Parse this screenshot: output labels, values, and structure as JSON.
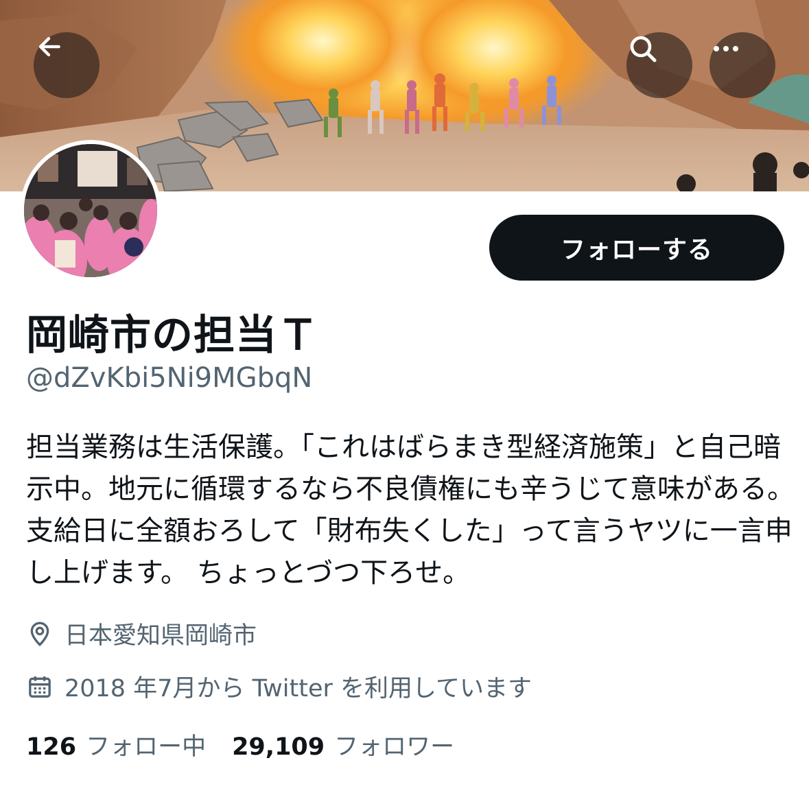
{
  "header": {
    "back_icon": "arrow-left-icon",
    "search_icon": "search-icon",
    "more_icon": "more-horizontal-icon"
  },
  "profile": {
    "display_name": "岡崎市の担当Ｔ",
    "handle": "@dZvKbi5Ni9MGbqN",
    "follow_label": "フォローする",
    "bio": "担当業務は生活保護。「これはばらまき型経済施策」と自己暗示中。地元に循環するなら不良債権にも辛うじて意味がある。 支給日に全額おろして「財布失くした」って言うヤツに一言申し上げます。 ちょっとづつ下ろせ。",
    "location": "日本愛知県岡崎市",
    "location_icon": "location-pin-icon",
    "joined": "2018 年7月から Twitter を利用しています",
    "joined_icon": "calendar-icon"
  },
  "stats": {
    "following_count": "126",
    "following_label": "フォロー中",
    "followers_count": "29,109",
    "followers_label": "フォロワー"
  },
  "colors": {
    "text_primary": "#0f1419",
    "text_secondary": "#536471",
    "button_bg": "#0f1419"
  }
}
